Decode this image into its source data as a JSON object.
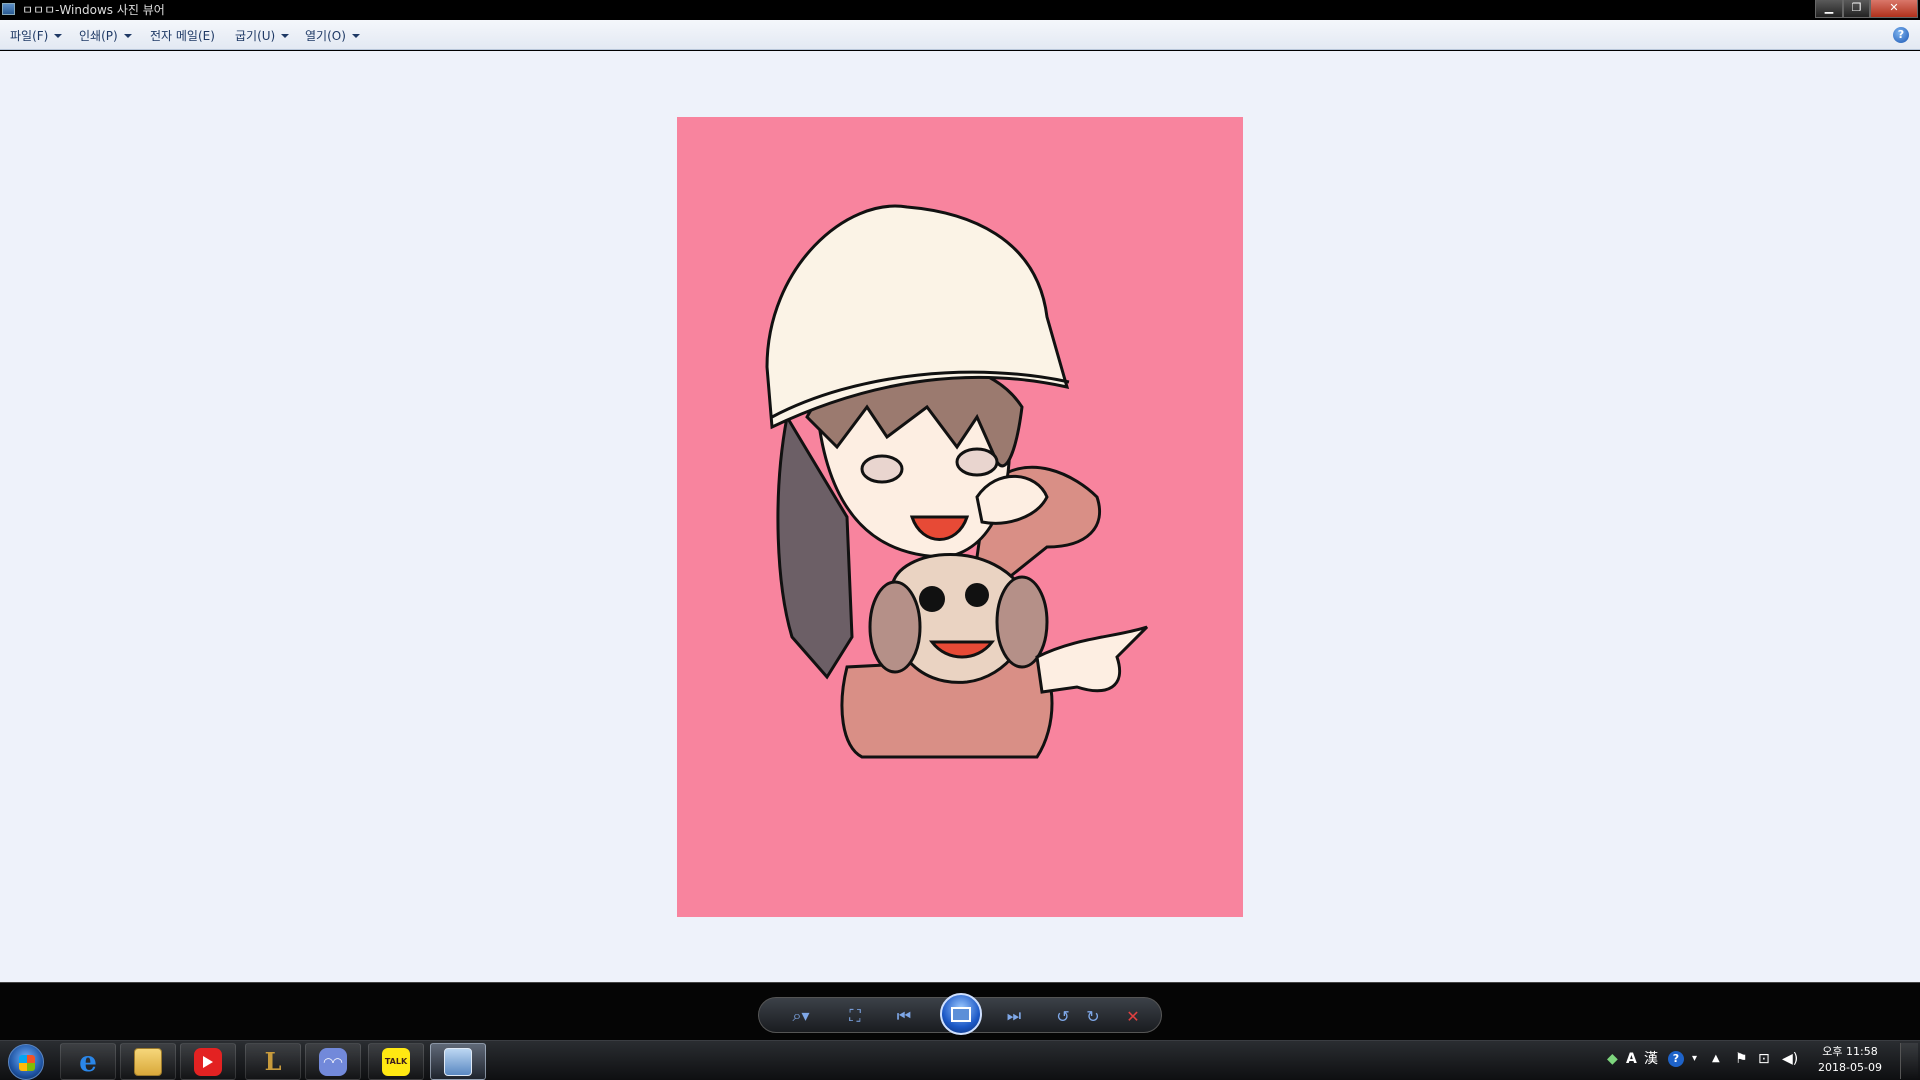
{
  "window": {
    "title": "ㅁㅁㅁ-Windows 사진 뷰어"
  },
  "menu": {
    "file": "파일(F)",
    "print": "인쇄(P)",
    "email": "전자 메일(E)",
    "burn": "굽기(U)",
    "open": "열기(O)"
  },
  "help": {
    "label": "?"
  },
  "controls": {
    "zoom": "zoom-icon",
    "fit": "actual-size-icon",
    "previous": "previous-icon",
    "slideshow": "slideshow-icon",
    "next": "next-icon",
    "rotate_ccw": "rotate-counterclockwise-icon",
    "rotate_cw": "rotate-clockwise-icon",
    "delete": "delete-icon"
  },
  "taskbar": {
    "apps": [
      "Internet Explorer",
      "Windows Explorer",
      "YouTube",
      "League of Legends",
      "Discord",
      "KakaoTalk",
      "Windows Photo Viewer"
    ],
    "kakao_label": "TALK"
  },
  "tray": {
    "ime_a": "A",
    "ime_han": "漢",
    "ime_help": "?",
    "time": "오후 11:58",
    "date": "2018-05-09"
  },
  "colors": {
    "photo_background": "#f8849e",
    "canvas": "#eef2fa"
  }
}
